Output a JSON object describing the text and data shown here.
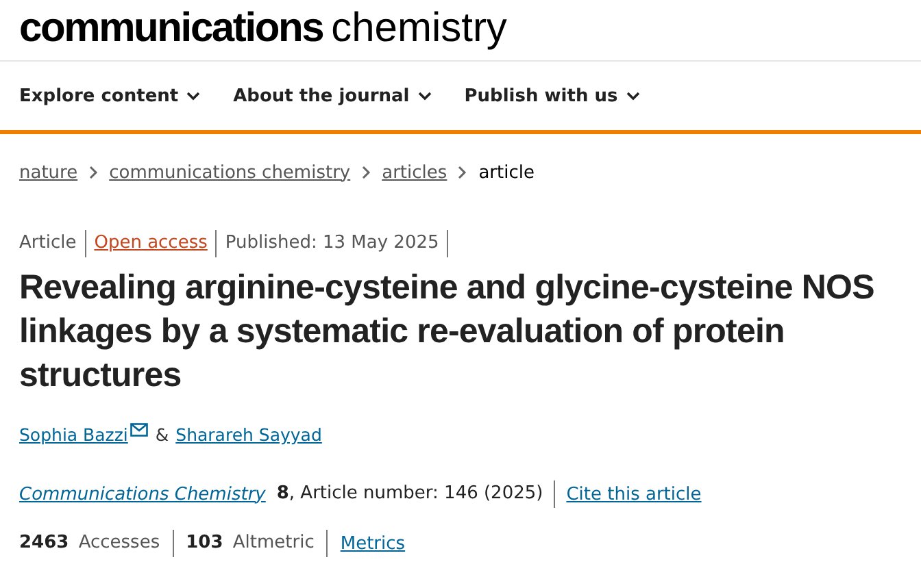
{
  "logo": {
    "bold": "communications",
    "light": "chemistry"
  },
  "nav": [
    {
      "label": "Explore content"
    },
    {
      "label": "About the journal"
    },
    {
      "label": "Publish with us"
    }
  ],
  "breadcrumb": [
    {
      "label": "nature",
      "kind": "link"
    },
    {
      "label": "communications chemistry",
      "kind": "link"
    },
    {
      "label": "articles",
      "kind": "link"
    },
    {
      "label": "article",
      "kind": "current"
    }
  ],
  "meta": [
    {
      "text": "Article",
      "kind": "text"
    },
    {
      "text": "Open access",
      "kind": "access"
    },
    {
      "text": "Published: 13 May 2025",
      "kind": "text"
    }
  ],
  "title": "Revealing arginine-cysteine and glycine-cysteine NOS linkages by a systematic re-evaluation of protein structures",
  "authors": [
    {
      "name": "Sophia Bazzi",
      "contact": true
    },
    {
      "name": "Sharareh Sayyad",
      "contact": false
    }
  ],
  "author_separator": "&",
  "citation": {
    "journal": "Communications Chemistry",
    "details": "**8**, Article number: 146 (2025)",
    "cite_link": "Cite this article"
  },
  "metrics": [
    {
      "text": "**2463** Accesses"
    },
    {
      "text": "**103** Altmetric"
    }
  ],
  "metrics_link": "Metrics"
}
